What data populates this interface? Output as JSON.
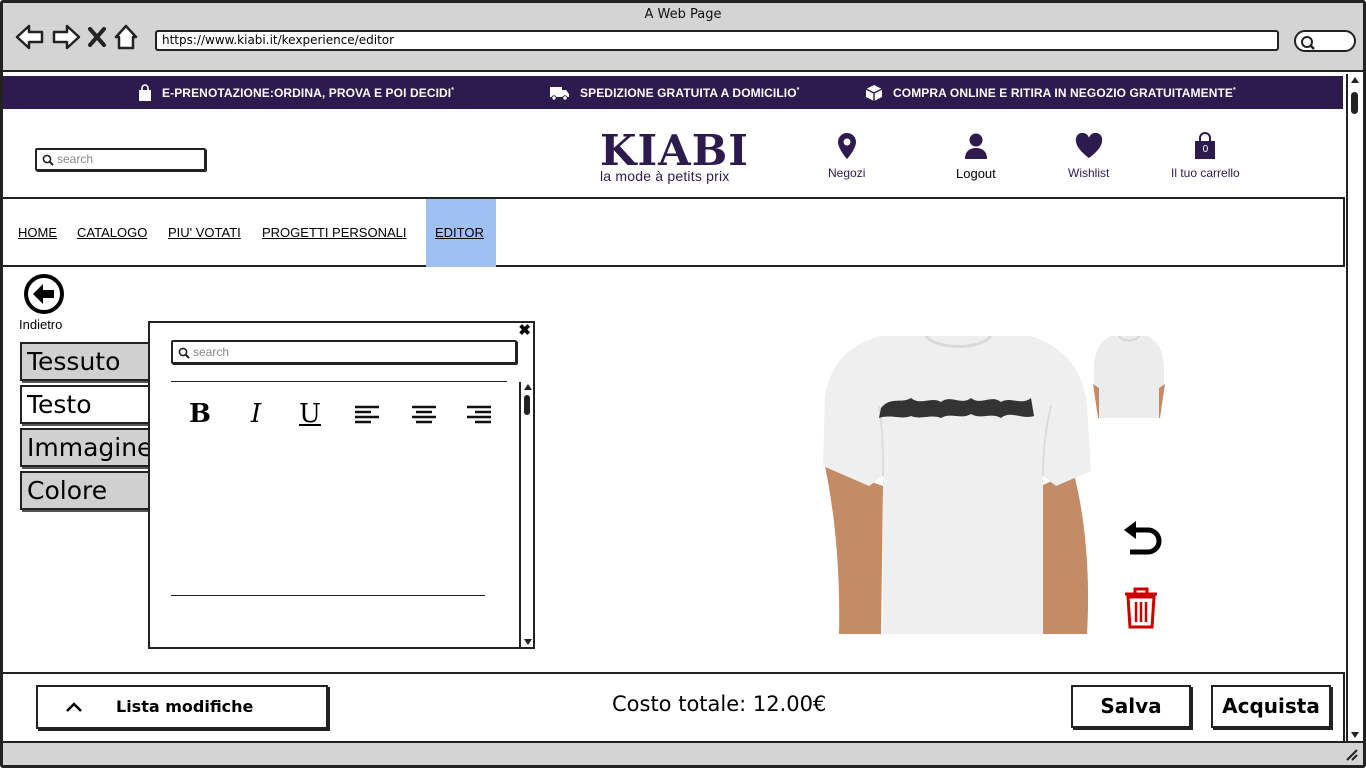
{
  "browser": {
    "window_title": "A Web Page",
    "url": "https://www.kiabi.it/kexperience/editor"
  },
  "promo": {
    "items": [
      {
        "icon": "shopping-bag-icon",
        "label": "E-PRENOTAZIONE:ORDINA, PROVA E POI DECIDI",
        "mark": "*"
      },
      {
        "icon": "delivery-truck-icon",
        "label": "SPEDIZIONE GRATUITA A DOMICILIO",
        "mark": "*"
      },
      {
        "icon": "package-box-icon",
        "label": "COMPRA ONLINE E RITIRA IN NEGOZIO GRATUITAMENTE",
        "mark": "*"
      }
    ],
    "bg_color": "#2d1a4f"
  },
  "header": {
    "search_placeholder": "search",
    "logo": {
      "word": "KIABI",
      "tagline": "la mode à petits prix"
    },
    "icons": [
      {
        "icon": "map-pin-icon",
        "label": "Negozi"
      },
      {
        "icon": "user-icon",
        "label": "Logout"
      },
      {
        "icon": "heart-icon",
        "label": "Wishlist"
      },
      {
        "icon": "shopping-bag-icon",
        "label": "Il tuo carrello",
        "count": "0"
      }
    ]
  },
  "menu": {
    "items": [
      {
        "label": "HOME"
      },
      {
        "label": "CATALOGO"
      },
      {
        "label": "PIU' VOTATI"
      },
      {
        "label": "PROGETTI PERSONALI"
      },
      {
        "label": "EDITOR",
        "active": true
      }
    ],
    "active_color": "#9ec0f3"
  },
  "editor": {
    "back_label": "Indietro",
    "tools": [
      {
        "label": "Tessuto"
      },
      {
        "label": "Testo",
        "active": true
      },
      {
        "label": "Immagine"
      },
      {
        "label": "Colore"
      }
    ],
    "text_panel": {
      "search_placeholder": "search",
      "close_glyph": "✖",
      "format_buttons": [
        {
          "glyph": "B",
          "name": "bold"
        },
        {
          "glyph": "I",
          "name": "italic"
        },
        {
          "glyph": "U",
          "name": "underline"
        },
        {
          "icon": "align-left-icon"
        },
        {
          "icon": "align-center-icon"
        },
        {
          "icon": "align-right-icon"
        }
      ]
    },
    "preview": {
      "actions": [
        {
          "icon": "undo-icon"
        },
        {
          "icon": "trash-icon",
          "color": "#cc0000"
        }
      ]
    }
  },
  "footer": {
    "list_label": "Lista modifiche",
    "total_label": "Costo totale: 12.00€",
    "save_label": "Salva",
    "buy_label": "Acquista"
  }
}
